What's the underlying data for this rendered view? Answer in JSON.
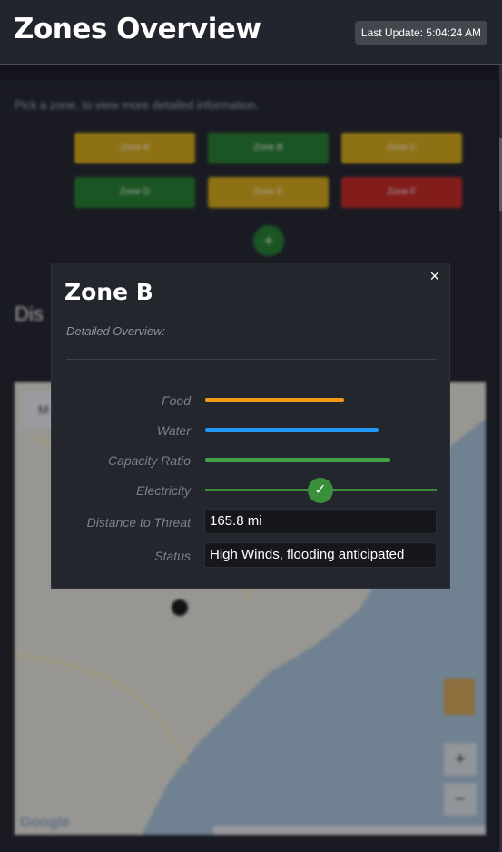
{
  "header": {
    "title": "Zones Overview",
    "last_update": "Last Update: 5:04:24 AM"
  },
  "background": {
    "intro": "Pick a zone, to view more detailed information.",
    "zones": [
      {
        "label": "Zone A",
        "color": "#b99013"
      },
      {
        "label": "Zone B",
        "color": "#1f6b27"
      },
      {
        "label": "Zone C",
        "color": "#b99013"
      },
      {
        "label": "Zone D",
        "color": "#1f6b27"
      },
      {
        "label": "Zone E",
        "color": "#b99013"
      },
      {
        "label": "Zone F",
        "color": "#a8201d"
      }
    ],
    "add_label": "+",
    "section_heading": "Dis",
    "map": {
      "menu_label": "M",
      "zoom_in": "+",
      "zoom_out": "−",
      "logo": "Google"
    }
  },
  "modal": {
    "close": "×",
    "title": "Zone B",
    "subtitle": "Detailed Overview:",
    "rows": {
      "food": {
        "label": "Food",
        "level": 0.6,
        "color": "#f29b13"
      },
      "water": {
        "label": "Water",
        "level": 0.75,
        "color": "#2196f3"
      },
      "capacity": {
        "label": "Capacity Ratio",
        "level": 0.8,
        "color": "#43a047"
      },
      "electricity": {
        "label": "Electricity",
        "state": "on",
        "knob": "✓",
        "color": "#3a8f3b"
      },
      "distance": {
        "label": "Distance to Threat",
        "value": "165.8 mi"
      },
      "status": {
        "label": "Status",
        "value": "High Winds, flooding anticipated"
      }
    }
  }
}
